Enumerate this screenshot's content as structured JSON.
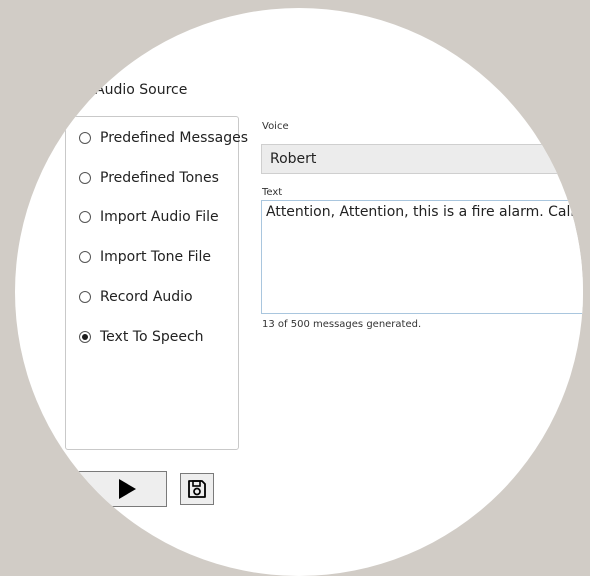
{
  "audio_source": {
    "title": "Audio Source",
    "options": [
      {
        "label": "Predefined Messages",
        "selected": false
      },
      {
        "label": "Predefined Tones",
        "selected": false
      },
      {
        "label": "Import Audio File",
        "selected": false
      },
      {
        "label": "Import Tone File",
        "selected": false
      },
      {
        "label": "Record Audio",
        "selected": false
      },
      {
        "label": "Text To Speech",
        "selected": true
      }
    ]
  },
  "voice": {
    "label": "Voice",
    "value": "Robert"
  },
  "text": {
    "label": "Text",
    "value": "Attention, Attention, this is a fire alarm. Calmly proc"
  },
  "status": {
    "text": "13 of 500 messages generated."
  },
  "controls": {
    "play_icon": "play-icon",
    "save_icon": "save-icon"
  }
}
